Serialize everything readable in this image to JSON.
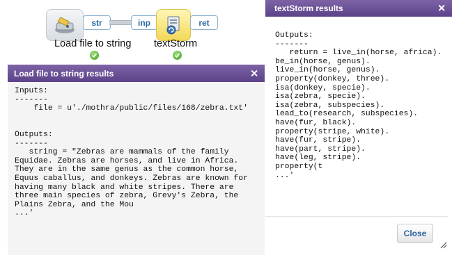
{
  "workflow": {
    "nodes": [
      {
        "label": "Load file to string",
        "icon": "disk-icon",
        "status": "ok"
      },
      {
        "label": "textStorm",
        "icon": "refresh-doc-icon",
        "status": "ok"
      }
    ],
    "ports": {
      "str": "str",
      "inp": "inp",
      "ret": "ret"
    }
  },
  "left_panel": {
    "title": "Load file to string results",
    "close": "✕",
    "lines": [
      "Inputs:",
      "-------",
      "    file = u'./mothra/public/files/168/zebra.txt'",
      "",
      "",
      "Outputs:",
      "-------",
      "   string = \"Zebras are mammals of the family",
      "Equidae. Zebras are horses, and live in Africa.",
      "They are in the same genus as the common horse,",
      "Equus caballus, and donkeys. Zebras are known for",
      "having many black and white stripes. There are",
      "three main species of zebra, Grevy's Zebra, the",
      "Plains Zebra, and the Mou",
      "...'"
    ]
  },
  "right_panel": {
    "title": "textStorm results",
    "close": "✕",
    "lines": [
      "Outputs:",
      "-------",
      "   return = live_in(horse, africa).",
      "be_in(horse, genus).",
      "live_in(horse, genus).",
      "property(donkey, three).",
      "isa(donkey, specie).",
      "isa(zebra, specie).",
      "isa(zebra, subspecies).",
      "lead_to(research, subspecies).",
      "have(fur, black).",
      "property(stripe, white).",
      "have(fur, stripe).",
      "have(part, stripe).",
      "have(leg, stripe).",
      "property(t",
      "...'"
    ],
    "close_button": "Close"
  },
  "colors": {
    "header_purple": "#6a4f97",
    "port_text": "#2b6aa6",
    "status_green": "#3f9e23"
  }
}
